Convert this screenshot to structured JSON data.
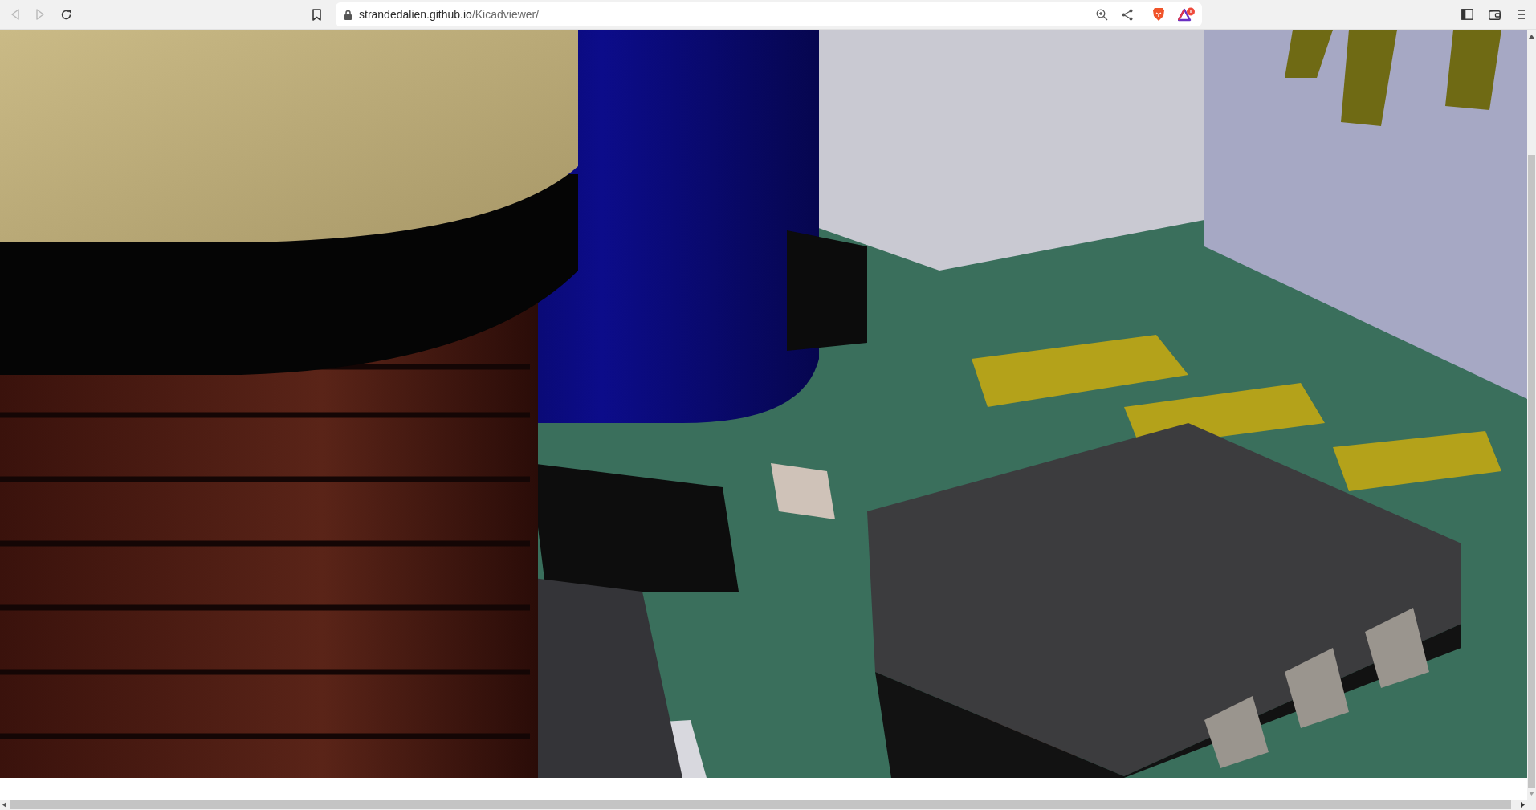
{
  "toolbar": {
    "back_button": {
      "disabled": true
    },
    "forward_button": {
      "disabled": true
    }
  },
  "address_bar": {
    "host": "strandedalien.github.io",
    "path": "/Kicadviewer/"
  }
}
